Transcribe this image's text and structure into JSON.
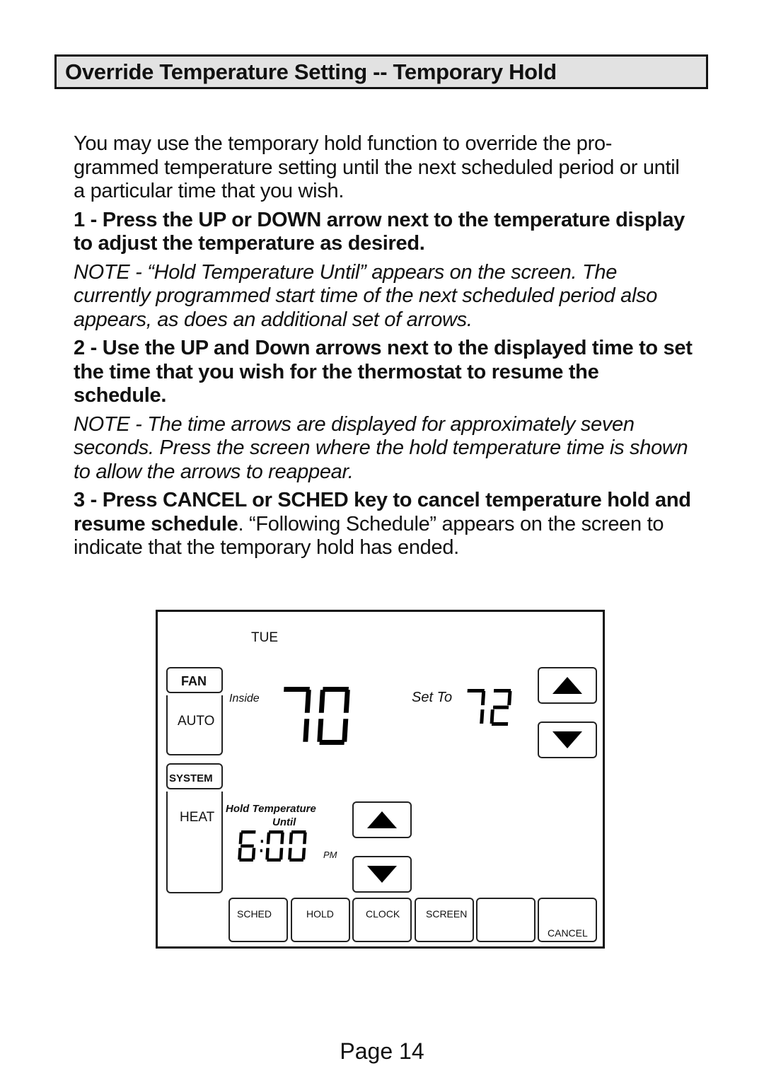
{
  "header": {
    "title": "Override Temperature Setting -- Temporary Hold"
  },
  "body": {
    "intro": "You may use the temporary hold function to override the pro- grammed temperature setting until the next scheduled period or until a particular time that you wish.",
    "step1": "1 - Press the UP or DOWN arrow next to the temperature display to adjust the temperature as desired.",
    "note1": "NOTE - “Hold Temperature Until” appears on the screen. The currently programmed start time of the next scheduled period also appears, as does an additional set of arrows.",
    "step2": "2 - Use the UP and Down arrows next to the displayed time to set the time that you wish for the thermostat to resume the schedule.",
    "note2": "NOTE - The time arrows are displayed for approximately seven seconds. Press the screen where the hold temperature time is shown to allow the arrows to reappear.",
    "step3_bold": "3 - Press CANCEL or SCHED key to cancel temperature hold and resume schedule",
    "step3_rest": ". “Following Schedule” appears on the screen to indicate that the temporary hold has ended."
  },
  "thermostat": {
    "day": "TUE",
    "fan": {
      "label": "FAN",
      "value": "AUTO"
    },
    "system": {
      "label": "SYSTEM",
      "value": "HEAT"
    },
    "inside_label": "Inside",
    "inside_temp": "70",
    "setto_label": "Set To",
    "setto_temp": "72",
    "hold_label_line1": "Hold Temperature",
    "hold_label_line2": "Until",
    "hold_time": "6:00",
    "hold_ampm": "PM",
    "icons": {
      "temp_up": "up-arrow-icon",
      "temp_down": "down-arrow-icon",
      "time_up": "up-arrow-icon",
      "time_down": "down-arrow-icon"
    },
    "keys": [
      "SCHED",
      "HOLD",
      "CLOCK",
      "SCREEN",
      "",
      "CANCEL"
    ]
  },
  "footer": {
    "page": "Page 14"
  }
}
